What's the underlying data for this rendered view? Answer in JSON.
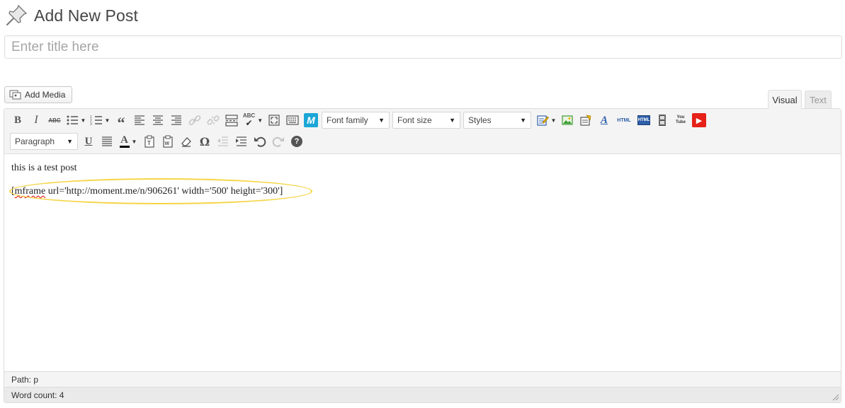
{
  "page": {
    "title": "Add New Post"
  },
  "title_input": {
    "placeholder": "Enter title here",
    "value": ""
  },
  "media": {
    "add_media_label": "Add Media"
  },
  "tabs": {
    "visual": "Visual",
    "text": "Text",
    "active": "visual"
  },
  "toolbar": {
    "row1_icons": [
      "bold-icon",
      "italic-icon",
      "strikethrough-icon",
      "bullet-list-icon",
      "numbered-list-icon",
      "blockquote-icon",
      "align-left-icon",
      "align-center-icon",
      "align-right-icon",
      "insert-link-icon",
      "unlink-icon",
      "more-tag-icon",
      "spellcheck-icon",
      "fullscreen-icon",
      "kitchen-sink-icon",
      "moment-plugin-icon"
    ],
    "bold_glyph": "B",
    "italic_glyph": "I",
    "strike_glyph": "ABC",
    "spell_glyph": "ABC",
    "font_family": "Font family",
    "font_size": "Font size",
    "styles": "Styles",
    "html_label": "HTML",
    "youtube_label": "You Tube",
    "paragraph": "Paragraph",
    "underline_glyph": "U",
    "textcolor_glyph": "A",
    "omega_glyph": "Ω",
    "help_glyph": "?",
    "colors": {
      "moment": "#1aa6d6",
      "youtube_red": "#e62117",
      "green": "#3f9c35",
      "blue": "#2e5ea8"
    }
  },
  "content": {
    "paragraph1": "this is a test post",
    "shortcode_word": "mframe",
    "shortcode_open": "[",
    "shortcode_rest": " url='http://moment.me/n/906261' width='500' height='300']"
  },
  "status": {
    "path": "Path: p",
    "word_count": "Word count: 4"
  },
  "highlight_color": "#f5d547"
}
